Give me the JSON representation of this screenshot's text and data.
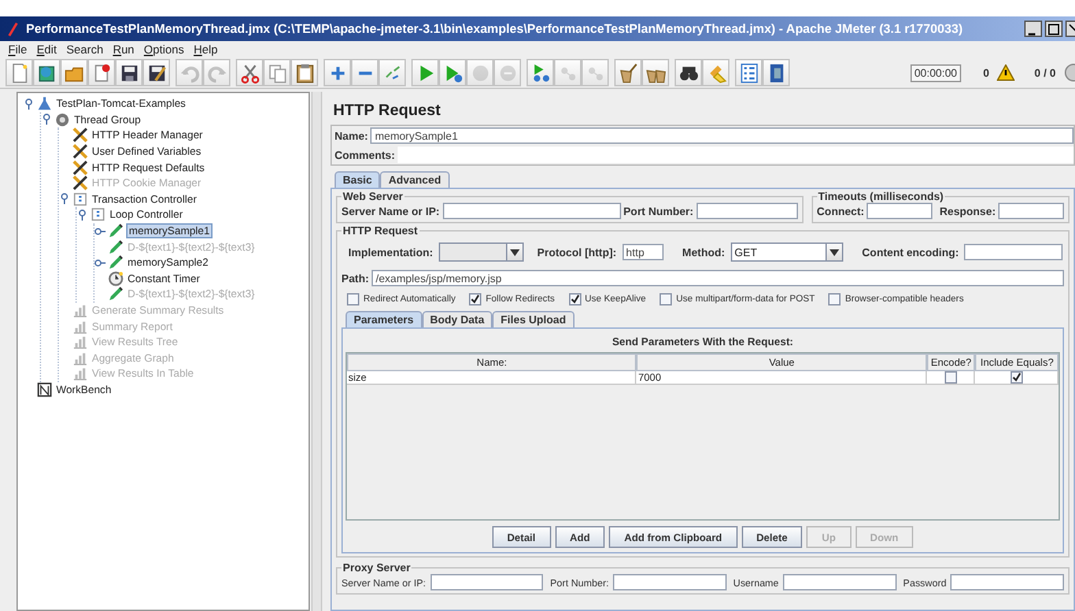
{
  "window": {
    "title": "PerformanceTestPlanMemoryThread.jmx (C:\\TEMP\\apache-jmeter-3.1\\bin\\examples\\PerformanceTestPlanMemoryThread.jmx) - Apache JMeter (3.1 r1770033)"
  },
  "menu": [
    {
      "label": "File",
      "mnemonic": true
    },
    {
      "label": "Edit",
      "mnemonic": true
    },
    {
      "label": "Search",
      "mnemonic": false
    },
    {
      "label": "Run",
      "mnemonic": true
    },
    {
      "label": "Options",
      "mnemonic": true
    },
    {
      "label": "Help",
      "mnemonic": true
    }
  ],
  "toolbar": {
    "groups": [
      [
        {
          "kind": "new",
          "disabled": false
        },
        {
          "kind": "templates",
          "disabled": false
        },
        {
          "kind": "open",
          "disabled": false
        },
        {
          "kind": "close",
          "disabled": false
        },
        {
          "kind": "save",
          "disabled": false
        },
        {
          "kind": "save-as",
          "disabled": false
        }
      ],
      [
        {
          "kind": "undo",
          "disabled": true
        },
        {
          "kind": "redo",
          "disabled": true
        }
      ],
      [
        {
          "kind": "cut",
          "disabled": false
        },
        {
          "kind": "copy",
          "disabled": false
        },
        {
          "kind": "paste",
          "disabled": false
        }
      ],
      [
        {
          "kind": "expand",
          "disabled": false
        },
        {
          "kind": "collapse",
          "disabled": false
        },
        {
          "kind": "toggle",
          "disabled": false
        }
      ],
      [
        {
          "kind": "start",
          "disabled": false
        },
        {
          "kind": "start-no-pause",
          "disabled": false
        },
        {
          "kind": "stop",
          "disabled": true
        },
        {
          "kind": "shutdown",
          "disabled": true
        }
      ],
      [
        {
          "kind": "remote-start",
          "disabled": false
        },
        {
          "kind": "remote-stop",
          "disabled": true
        },
        {
          "kind": "remote-exit",
          "disabled": true
        }
      ],
      [
        {
          "kind": "clear",
          "disabled": false
        },
        {
          "kind": "clear-all",
          "disabled": false
        }
      ],
      [
        {
          "kind": "search",
          "disabled": false
        },
        {
          "kind": "reset-search",
          "disabled": false
        }
      ],
      [
        {
          "kind": "function-helper",
          "disabled": false
        },
        {
          "kind": "help",
          "disabled": false
        }
      ]
    ],
    "timer": "00:00:00",
    "error_count": "0",
    "threads": "0 / 0"
  },
  "tree": [
    {
      "label": "TestPlan-Tomcat-Examples",
      "kind": "plan",
      "handle": true,
      "expanded": true,
      "disabled": false,
      "selected": false,
      "children": [
        {
          "label": "Thread Group",
          "kind": "thread-group",
          "handle": true,
          "expanded": true,
          "disabled": false,
          "selected": false,
          "children": [
            {
              "label": "HTTP Header Manager",
              "kind": "config",
              "handle": false,
              "disabled": false,
              "selected": false
            },
            {
              "label": "User Defined Variables",
              "kind": "config",
              "handle": false,
              "disabled": false,
              "selected": false
            },
            {
              "label": "HTTP Request Defaults",
              "kind": "config",
              "handle": false,
              "disabled": false,
              "selected": false
            },
            {
              "label": "HTTP Cookie Manager",
              "kind": "config",
              "handle": false,
              "disabled": true,
              "selected": false
            },
            {
              "label": "Transaction Controller",
              "kind": "controller",
              "handle": true,
              "expanded": true,
              "disabled": false,
              "selected": false,
              "children": [
                {
                  "label": "Loop Controller",
                  "kind": "controller",
                  "handle": true,
                  "expanded": true,
                  "disabled": false,
                  "selected": false,
                  "children": [
                    {
                      "label": "memorySample1",
                      "kind": "sampler",
                      "handle": true,
                      "expanded": false,
                      "disabled": false,
                      "selected": true
                    },
                    {
                      "label": "D-${text1}-${text2}-${text3}",
                      "kind": "sampler",
                      "handle": false,
                      "disabled": true,
                      "selected": false
                    },
                    {
                      "label": "memorySample2",
                      "kind": "sampler",
                      "handle": true,
                      "expanded": false,
                      "disabled": false,
                      "selected": false
                    },
                    {
                      "label": "Constant Timer",
                      "kind": "timer",
                      "handle": false,
                      "disabled": false,
                      "selected": false
                    },
                    {
                      "label": "D-${text1}-${text2}-${text3}",
                      "kind": "sampler",
                      "handle": false,
                      "disabled": true,
                      "selected": false
                    }
                  ]
                }
              ]
            },
            {
              "label": "Generate Summary Results",
              "kind": "listener",
              "handle": false,
              "disabled": true,
              "selected": false
            },
            {
              "label": "Summary Report",
              "kind": "listener",
              "handle": false,
              "disabled": true,
              "selected": false
            },
            {
              "label": "View Results Tree",
              "kind": "listener",
              "handle": false,
              "disabled": true,
              "selected": false
            },
            {
              "label": "Aggregate Graph",
              "kind": "listener",
              "handle": false,
              "disabled": true,
              "selected": false
            },
            {
              "label": "View Results In Table",
              "kind": "listener",
              "handle": false,
              "disabled": true,
              "selected": false
            }
          ]
        }
      ]
    },
    {
      "label": "WorkBench",
      "kind": "workbench",
      "handle": false,
      "disabled": false,
      "selected": false
    }
  ],
  "editor": {
    "title": "HTTP Request",
    "name_label": "Name:",
    "name": "memorySample1",
    "comments_label": "Comments:",
    "tabs": [
      {
        "label": "Basic",
        "selected": true
      },
      {
        "label": "Advanced",
        "selected": false
      }
    ],
    "web_server": {
      "legend": "Web Server",
      "server_label": "Server Name or IP:",
      "port_label": "Port Number:"
    },
    "timeouts": {
      "legend": "Timeouts (milliseconds)",
      "connect_label": "Connect:",
      "response_label": "Response:"
    },
    "http_request": {
      "legend": "HTTP Request",
      "implementation_label": "Implementation:",
      "protocol_label": "Protocol [http]:",
      "protocol": "http",
      "method_label": "Method:",
      "method": "GET",
      "encoding_label": "Content encoding:",
      "path_label": "Path:",
      "path": "/examples/jsp/memory.jsp"
    },
    "options": [
      {
        "label": "Redirect Automatically",
        "checked": false
      },
      {
        "label": "Follow Redirects",
        "checked": true
      },
      {
        "label": "Use KeepAlive",
        "checked": true
      },
      {
        "label": "Use multipart/form-data for POST",
        "checked": false
      },
      {
        "label": "Browser-compatible headers",
        "checked": false
      }
    ],
    "param_tabs": [
      {
        "label": "Parameters",
        "selected": true
      },
      {
        "label": "Body Data",
        "selected": false
      },
      {
        "label": "Files Upload",
        "selected": false
      }
    ],
    "params": {
      "caption": "Send Parameters With the Request:",
      "columns": [
        "Name:",
        "Value",
        "Encode?",
        "Include Equals?"
      ],
      "rows": [
        {
          "name": "size",
          "value": "7000",
          "encode": false,
          "include_equals": true
        }
      ]
    },
    "buttons": [
      {
        "label": "Detail",
        "disabled": false
      },
      {
        "label": "Add",
        "disabled": false
      },
      {
        "label": "Add from Clipboard",
        "disabled": false
      },
      {
        "label": "Delete",
        "disabled": false
      },
      {
        "label": "Up",
        "disabled": true
      },
      {
        "label": "Down",
        "disabled": true
      }
    ],
    "proxy": {
      "legend": "Proxy Server",
      "fields": [
        "Server Name or IP:",
        "Port Number:",
        "Username",
        "Password"
      ]
    }
  }
}
